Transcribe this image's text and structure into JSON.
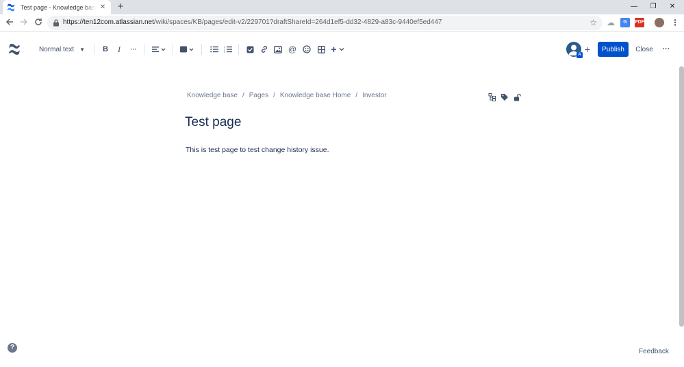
{
  "browser": {
    "tab_title": "Test page - Knowledge base - Confluence",
    "tab_close": "✕",
    "new_tab": "+",
    "window": {
      "minimize": "—",
      "restore": "❐",
      "close": "✕"
    },
    "url_main": "https://ten12com.atlassian.net",
    "url_rest": "/wiki/spaces/KB/pages/edit-v2/229701?draftShareId=264d1ef5-dd32-4829-a83c-9440ef5ed447",
    "extensions": [
      "cloud-icon",
      "translate-icon",
      "pdf-icon",
      "profile-avatar",
      "menu-icon"
    ],
    "pdf_label": "PDF"
  },
  "editor": {
    "text_style": "Normal text",
    "toolbar_icons": [
      "bold-icon",
      "italic-icon",
      "more-formatting-icon",
      "align-icon",
      "text-color-icon",
      "bullet-list-icon",
      "numbered-list-icon",
      "action-item-icon",
      "link-icon",
      "image-icon",
      "mention-icon",
      "emoji-icon",
      "table-icon",
      "insert-icon"
    ],
    "bold": "B",
    "italic": "I",
    "ellipsis": "···",
    "at": "@",
    "plus": "+",
    "avatar_badge": "A",
    "publish_label": "Publish",
    "close_label": "Close",
    "more_label": "···"
  },
  "page": {
    "breadcrumb": [
      "Knowledge base",
      "Pages",
      "Knowledge base Home",
      "Investor"
    ],
    "breadcrumb_separator": "/",
    "title": "Test page",
    "body": "This is test page to test change history issue."
  },
  "footer": {
    "help": "?",
    "feedback": "Feedback"
  },
  "colors": {
    "brand": "#0052cc",
    "text": "#172b4d",
    "subtle": "#6b778c"
  }
}
